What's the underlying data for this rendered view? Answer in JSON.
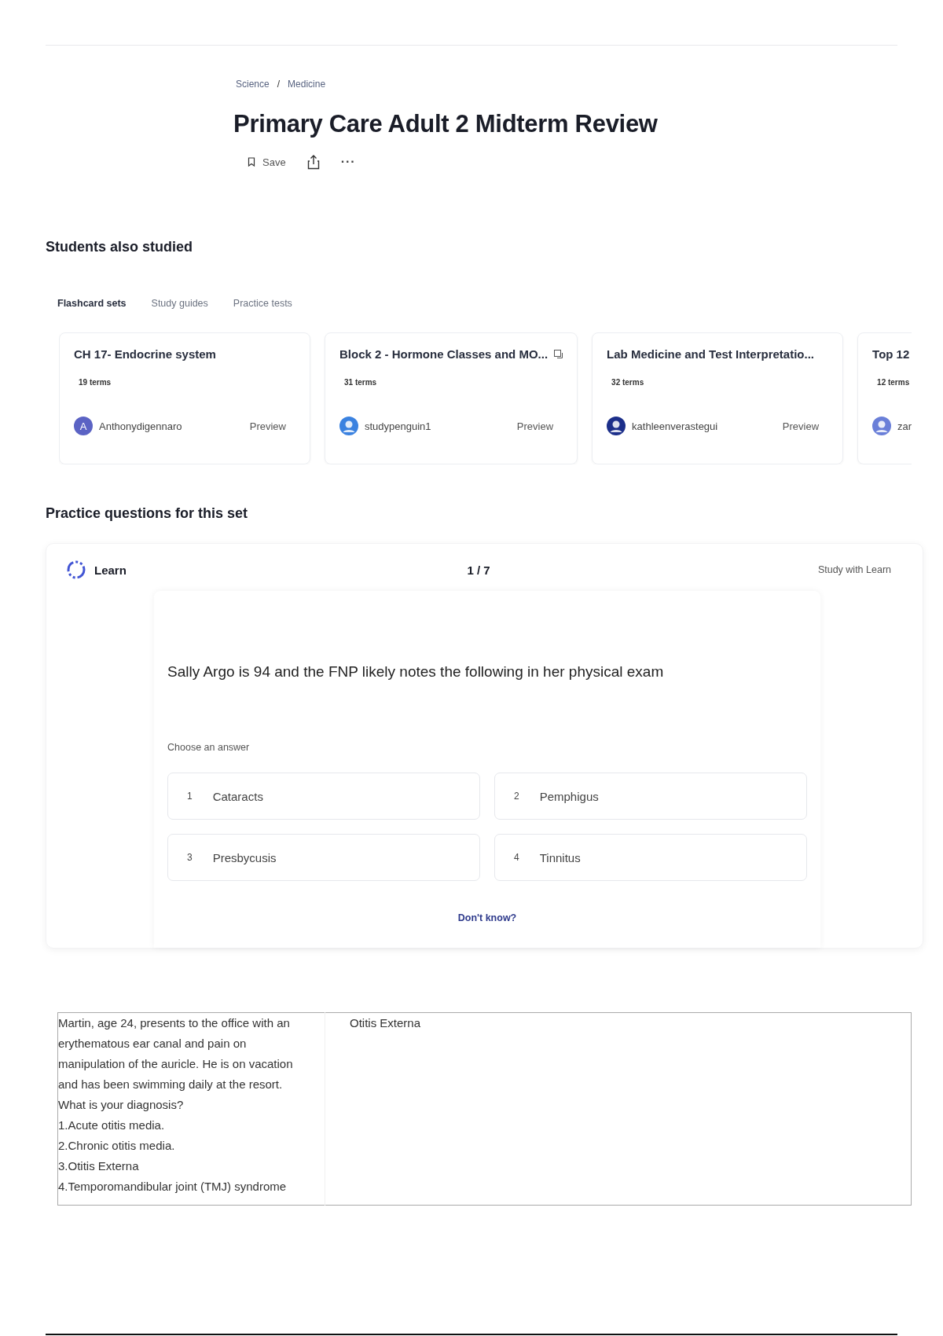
{
  "breadcrumb": [
    "Science",
    "Medicine"
  ],
  "breadcrumb_separator": "/",
  "title": "Primary Care Adult 2 Midterm Review",
  "actions": {
    "save": "Save",
    "more": "···"
  },
  "also_studied": {
    "heading": "Students also studied",
    "tabs": [
      {
        "label": "Flashcard sets",
        "selected": true
      },
      {
        "label": "Study guides",
        "selected": false
      },
      {
        "label": "Practice tests",
        "selected": false
      }
    ],
    "cards": [
      {
        "title": "CH 17- Endocrine system",
        "terms": "19 terms",
        "author": "Anthonydigennaro",
        "avatar": {
          "initial": "A",
          "color": "#5b63c4"
        },
        "preview": "Preview"
      },
      {
        "title": "Block 2 - Hormone Classes and MO...",
        "badge": true,
        "terms": "31 terms",
        "author": "studypenguin1",
        "avatar": {
          "color": "#3b82e0"
        },
        "preview": "Preview"
      },
      {
        "title": "Lab Medicine and Test Interpretatio...",
        "terms": "32 terms",
        "author": "kathleenverastegui",
        "avatar": {
          "color": "#1c2f8a"
        },
        "preview": "Preview"
      },
      {
        "title": "Top 12",
        "terms": "12 terms",
        "author": "zar",
        "avatar": {
          "color": "#6a7fd8"
        }
      }
    ]
  },
  "practice": {
    "heading": "Practice questions for this set",
    "mode": "Learn",
    "progress": "1 / 7",
    "study_link": "Study with Learn",
    "question": "Sally Argo is 94 and the FNP likely notes the following in her physical exam",
    "prompt": "Choose an answer",
    "options": [
      {
        "number": "1",
        "text": "Cataracts"
      },
      {
        "number": "2",
        "text": "Pemphigus"
      },
      {
        "number": "3",
        "text": "Presbycusis"
      },
      {
        "number": "4",
        "text": "Tinnitus"
      }
    ],
    "dont_know": "Don't know?"
  },
  "table": {
    "rows": [
      {
        "term": "Martin, age 24, presents to the office with an erythematous ear canal and pain on manipulation of the auricle. He is on vacation and has been swimming daily at the resort. What is your diagnosis?\n1.Acute otitis media.\n2.Chronic otitis media.\n3.Otitis Externa\n4.Temporomandibular joint (TMJ) syndrome",
        "definition": "Otitis Externa"
      }
    ]
  }
}
